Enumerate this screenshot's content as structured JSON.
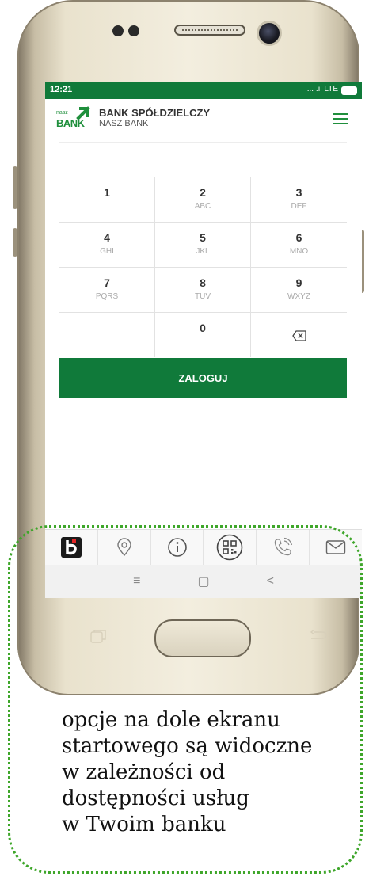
{
  "status_bar": {
    "time": "12:21",
    "network": "... .ıl LTE"
  },
  "app_bar": {
    "logo_small": "nasz",
    "logo_big": "BANK",
    "bank_name": "BANK SPÓŁDZIELCZY",
    "bank_subtitle": "NASZ BANK"
  },
  "keypad": {
    "keys": [
      {
        "digit": "1",
        "letters": ""
      },
      {
        "digit": "2",
        "letters": "ABC"
      },
      {
        "digit": "3",
        "letters": "DEF"
      },
      {
        "digit": "4",
        "letters": "GHI"
      },
      {
        "digit": "5",
        "letters": "JKL"
      },
      {
        "digit": "6",
        "letters": "MNO"
      },
      {
        "digit": "7",
        "letters": "PQRS"
      },
      {
        "digit": "8",
        "letters": "TUV"
      },
      {
        "digit": "9",
        "letters": "WXYZ"
      },
      {
        "digit": "",
        "letters": ""
      },
      {
        "digit": "0",
        "letters": ""
      }
    ]
  },
  "login_button": "ZALOGUJ",
  "bottom_tabs": [
    "b-logo-icon",
    "location-pin-icon",
    "info-icon",
    "qr-code-icon",
    "phone-call-icon",
    "mail-icon"
  ],
  "navbar": {
    "menu": "≡",
    "home": "▢",
    "back": "<"
  },
  "caption": {
    "line1": "opcje na dole ekranu",
    "line2": "startowego są widoczne",
    "line3": "w zależności od",
    "line4": "dostępności usług",
    "line5": "w Twoim banku"
  },
  "colors": {
    "brand_green": "#107a3a",
    "callout_green": "#3ea62a"
  }
}
